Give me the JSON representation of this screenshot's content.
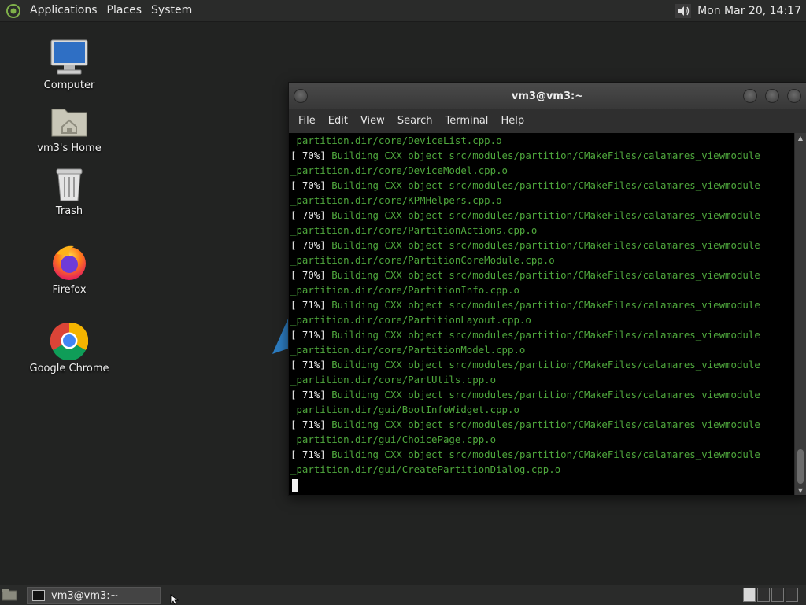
{
  "top_panel": {
    "menus": [
      "Applications",
      "Places",
      "System"
    ],
    "clock": "Mon Mar 20, 14:17",
    "icons": [
      "mate-logo-icon",
      "volume-icon"
    ]
  },
  "desktop_icons": [
    {
      "label": "Computer",
      "icon": "computer-icon"
    },
    {
      "label": "vm3's Home",
      "icon": "home-folder-icon"
    },
    {
      "label": "Trash",
      "icon": "trash-icon"
    },
    {
      "label": "Firefox",
      "icon": "firefox-icon"
    },
    {
      "label": "Google Chrome",
      "icon": "chrome-icon"
    }
  ],
  "terminal": {
    "title": "vm3@vm3:~",
    "menu": [
      "File",
      "Edit",
      "View",
      "Search",
      "Terminal",
      "Help"
    ],
    "lines": [
      {
        "pct": "",
        "text": "_partition.dir/core/DeviceList.cpp.o"
      },
      {
        "pct": "[ 70%]",
        "text": " Building CXX object src/modules/partition/CMakeFiles/calamares_viewmodule"
      },
      {
        "pct": "",
        "text": "_partition.dir/core/DeviceModel.cpp.o"
      },
      {
        "pct": "[ 70%]",
        "text": " Building CXX object src/modules/partition/CMakeFiles/calamares_viewmodule"
      },
      {
        "pct": "",
        "text": "_partition.dir/core/KPMHelpers.cpp.o"
      },
      {
        "pct": "[ 70%]",
        "text": " Building CXX object src/modules/partition/CMakeFiles/calamares_viewmodule"
      },
      {
        "pct": "",
        "text": "_partition.dir/core/PartitionActions.cpp.o"
      },
      {
        "pct": "[ 70%]",
        "text": " Building CXX object src/modules/partition/CMakeFiles/calamares_viewmodule"
      },
      {
        "pct": "",
        "text": "_partition.dir/core/PartitionCoreModule.cpp.o"
      },
      {
        "pct": "[ 70%]",
        "text": " Building CXX object src/modules/partition/CMakeFiles/calamares_viewmodule"
      },
      {
        "pct": "",
        "text": "_partition.dir/core/PartitionInfo.cpp.o"
      },
      {
        "pct": "[ 71%]",
        "text": " Building CXX object src/modules/partition/CMakeFiles/calamares_viewmodule"
      },
      {
        "pct": "",
        "text": "_partition.dir/core/PartitionLayout.cpp.o"
      },
      {
        "pct": "[ 71%]",
        "text": " Building CXX object src/modules/partition/CMakeFiles/calamares_viewmodule"
      },
      {
        "pct": "",
        "text": "_partition.dir/core/PartitionModel.cpp.o"
      },
      {
        "pct": "[ 71%]",
        "text": " Building CXX object src/modules/partition/CMakeFiles/calamares_viewmodule"
      },
      {
        "pct": "",
        "text": "_partition.dir/core/PartUtils.cpp.o"
      },
      {
        "pct": "[ 71%]",
        "text": " Building CXX object src/modules/partition/CMakeFiles/calamares_viewmodule"
      },
      {
        "pct": "",
        "text": "_partition.dir/gui/BootInfoWidget.cpp.o"
      },
      {
        "pct": "[ 71%]",
        "text": " Building CXX object src/modules/partition/CMakeFiles/calamares_viewmodule"
      },
      {
        "pct": "",
        "text": "_partition.dir/gui/ChoicePage.cpp.o"
      },
      {
        "pct": "[ 71%]",
        "text": " Building CXX object src/modules/partition/CMakeFiles/calamares_viewmodule"
      },
      {
        "pct": "",
        "text": "_partition.dir/gui/CreatePartitionDialog.cpp.o"
      }
    ],
    "colors": {
      "text_green": "#4fa83d",
      "background": "#000000"
    }
  },
  "bottom_panel": {
    "task_label": "vm3@vm3:~"
  }
}
